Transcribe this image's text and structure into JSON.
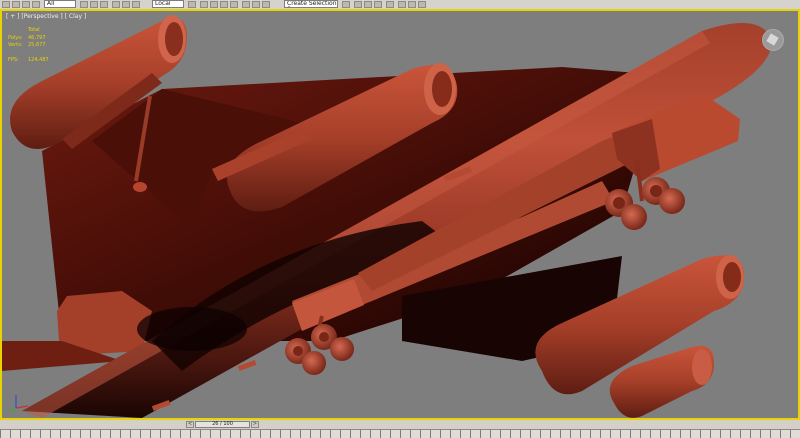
{
  "toolbar": {
    "selection_filter": "All",
    "ref_coord": "Local",
    "selection_set": "Create Selection Se"
  },
  "viewport": {
    "label": "[ + ] [Perspective ] [ Clay ]",
    "stats": {
      "total_label": "Total",
      "polys_label": "Polys:",
      "polys_value": "46,797",
      "verts_label": "Verts:",
      "verts_value": "25,677",
      "fps_label": "FPS:",
      "fps_value": "124.487"
    },
    "viewcube_icon": "viewcube-icon",
    "axis_icon": "axis-tripod-icon"
  },
  "timeline": {
    "frame_label": "26 / 100",
    "prev_label": "<",
    "next_label": ">"
  },
  "colors": {
    "model": "#b6452e",
    "viewport_bg": "#7e7e7e",
    "active_border": "#e8d400"
  }
}
